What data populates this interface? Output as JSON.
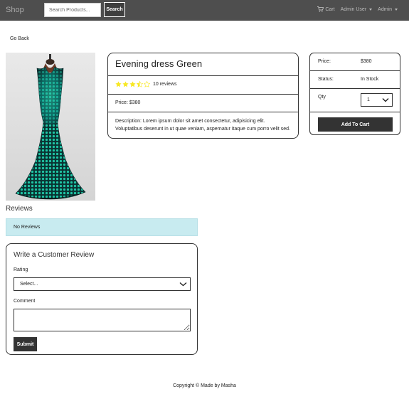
{
  "navbar": {
    "brand": "Shop",
    "search_placeholder": "Search Products...",
    "search_button": "Search",
    "cart_label": "Cart",
    "user_menu": "Admin User",
    "admin_menu": "Admin"
  },
  "go_back": "Go Back",
  "product": {
    "name": "Evening dress Green",
    "rating": 3.5,
    "reviews_text": "10 reviews",
    "price_text": "Price: $380",
    "description": "Description: Lorem ipsum dolor sit amet consectetur, adipisicing elit. Voluptatibus deserunt in ut quae veniam, aspernatur itaque cum porro velit sed.",
    "image_alt": "evening-dress-green"
  },
  "purchase": {
    "price_label": "Price:",
    "price_value": "$380",
    "status_label": "Status:",
    "status_value": "In Stock",
    "qty_label": "Qty",
    "qty_value": "1",
    "add_button": "Add To Cart"
  },
  "reviews": {
    "title": "Reviews",
    "empty_message": "No Reviews",
    "form_title": "Write a Customer Review",
    "rating_label": "Rating",
    "rating_placeholder": "Select...",
    "comment_label": "Comment",
    "submit_button": "Submit"
  },
  "footer": "Copyright © Made by Masha",
  "colors": {
    "navbar": "#4e4e4e",
    "star": "#f8e825",
    "alert": "#c8ebf0",
    "button": "#333333"
  }
}
